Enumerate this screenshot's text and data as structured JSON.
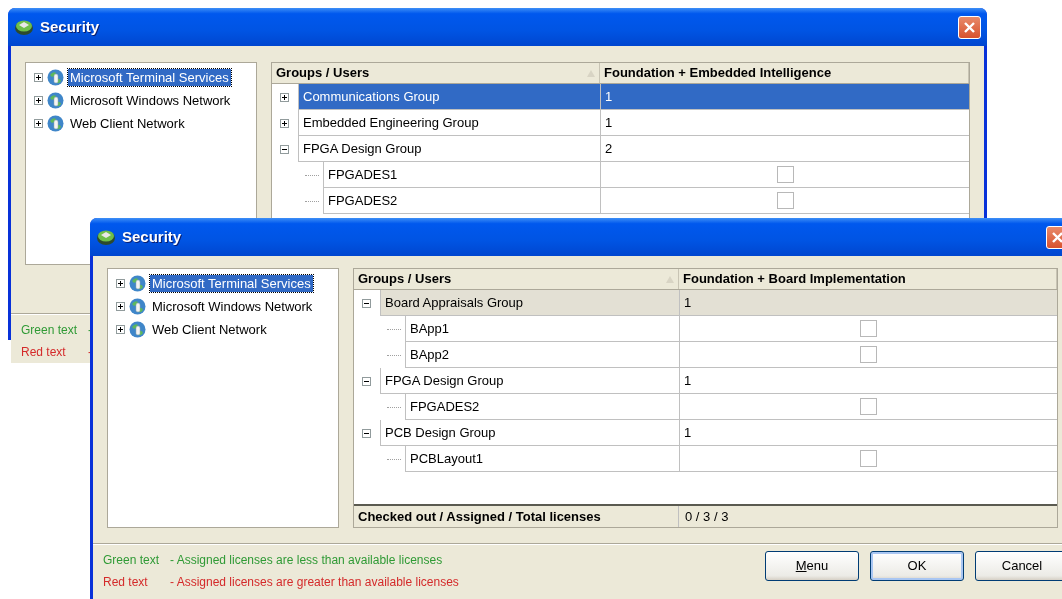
{
  "windows": [
    {
      "title": "Security",
      "tree": [
        {
          "label": "Microsoft Terminal Services",
          "expanded": false,
          "selected": true
        },
        {
          "label": "Microsoft Windows Network",
          "expanded": false,
          "selected": false
        },
        {
          "label": "Web Client Network",
          "expanded": false,
          "selected": false
        }
      ],
      "grid": {
        "focused": true,
        "columns": [
          "Groups / Users",
          "Foundation + Embedded Intelligence"
        ],
        "rows": [
          {
            "name": "Communications Group",
            "value": "1",
            "expanded": false,
            "selected": true
          },
          {
            "name": "Embedded Engineering Group",
            "value": "1",
            "expanded": false,
            "selected": false
          },
          {
            "name": "FPGA Design Group",
            "value": "2",
            "expanded": true,
            "selected": false,
            "children": [
              {
                "name": "FPGADES1",
                "checked": false,
                "selected": false
              },
              {
                "name": "FPGADES2",
                "checked": false,
                "selected": false
              }
            ]
          }
        ]
      },
      "legend": [
        {
          "label": "Green text",
          "description": "-",
          "color": "#2f9a35"
        },
        {
          "label": "Red text",
          "description": "-",
          "color": "#d42a2a"
        }
      ]
    },
    {
      "title": "Security",
      "tree": [
        {
          "label": "Microsoft Terminal Services",
          "expanded": false,
          "selected": true
        },
        {
          "label": "Microsoft Windows Network",
          "expanded": false,
          "selected": false
        },
        {
          "label": "Web Client Network",
          "expanded": false,
          "selected": false
        }
      ],
      "grid": {
        "focused": false,
        "columns": [
          "Groups / Users",
          "Foundation + Board Implementation"
        ],
        "rows": [
          {
            "name": "Board Appraisals Group",
            "value": "1",
            "expanded": true,
            "selected": true,
            "children": [
              {
                "name": "BApp1",
                "checked": false,
                "selected": false
              },
              {
                "name": "BApp2",
                "checked": false,
                "selected": false
              }
            ]
          },
          {
            "name": "FPGA Design Group",
            "value": "1",
            "expanded": true,
            "selected": false,
            "children": [
              {
                "name": "FPGADES2",
                "checked": false,
                "selected": false
              }
            ]
          },
          {
            "name": "PCB Design Group",
            "value": "1",
            "expanded": true,
            "selected": false,
            "children": [
              {
                "name": "PCBLayout1",
                "checked": false,
                "selected": false
              }
            ]
          }
        ],
        "footer": {
          "label": "Checked out / Assigned / Total licenses",
          "value": "0 / 3 / 3"
        }
      },
      "legend": [
        {
          "label": "Green text",
          "description": "- Assigned licenses are less than available licenses",
          "color": "#2f9a35"
        },
        {
          "label": "Red text",
          "description": "- Assigned licenses are greater than available licenses",
          "color": "#d42a2a"
        }
      ],
      "buttons": [
        {
          "label": "Menu",
          "default": false,
          "access_key": true
        },
        {
          "label": "OK",
          "default": true,
          "access_key": false
        },
        {
          "label": "Cancel",
          "default": false,
          "access_key": false
        }
      ]
    }
  ]
}
